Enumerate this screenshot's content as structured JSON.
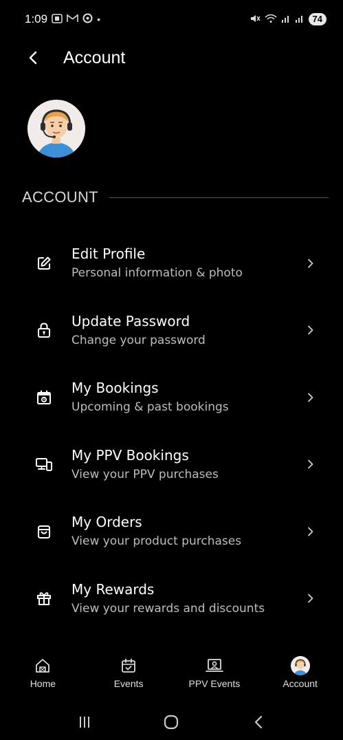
{
  "status_bar": {
    "time": "1:09",
    "notif_icons": [
      "screenshot-icon",
      "gmail-icon",
      "app-icon",
      "dot-icon"
    ],
    "right_icons": [
      "mute-icon",
      "wifi-icon",
      "signal-icon",
      "signal-icon"
    ],
    "battery": "74"
  },
  "header": {
    "title": "Account"
  },
  "section": {
    "title": "ACCOUNT"
  },
  "menu": [
    {
      "title": "Edit Profile",
      "subtitle": "Personal information & photo",
      "icon": "edit-icon"
    },
    {
      "title": "Update Password",
      "subtitle": "Change your password",
      "icon": "lock-icon"
    },
    {
      "title": "My Bookings",
      "subtitle": "Upcoming & past bookings",
      "icon": "calendar-icon"
    },
    {
      "title": "My PPV Bookings",
      "subtitle": "View your PPV purchases",
      "icon": "devices-icon"
    },
    {
      "title": "My Orders",
      "subtitle": "View your product purchases",
      "icon": "bag-icon"
    },
    {
      "title": "My Rewards",
      "subtitle": "View your rewards and discounts",
      "icon": "gift-icon"
    }
  ],
  "bottom_nav": [
    {
      "label": "Home",
      "icon": "home-icon"
    },
    {
      "label": "Events",
      "icon": "calendar-check-icon"
    },
    {
      "label": "PPV Events",
      "icon": "laptop-user-icon"
    },
    {
      "label": "Account",
      "icon": "avatar-icon",
      "active": true
    }
  ],
  "colors": {
    "background": "#000000",
    "text": "#ffffff",
    "subtext": "#bdbdbd",
    "divider": "#555555"
  }
}
